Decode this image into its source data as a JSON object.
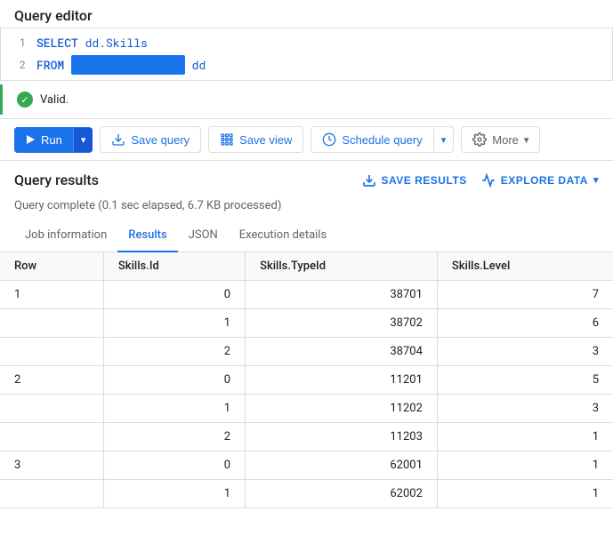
{
  "editor": {
    "label": "Query editor",
    "lines": [
      {
        "number": "1",
        "parts": [
          {
            "type": "keyword",
            "text": "SELECT"
          },
          {
            "type": "space",
            "text": " "
          },
          {
            "type": "field",
            "text": "dd.Skills"
          }
        ]
      },
      {
        "number": "2",
        "parts": [
          {
            "type": "keyword",
            "text": "FROM"
          },
          {
            "type": "space",
            "text": " "
          },
          {
            "type": "highlighted",
            "text": "                                                          "
          },
          {
            "type": "space",
            "text": " "
          },
          {
            "type": "field",
            "text": "dd"
          }
        ]
      }
    ]
  },
  "valid": {
    "text": "Valid."
  },
  "toolbar": {
    "run_label": "Run",
    "save_query_label": "Save query",
    "save_view_label": "Save view",
    "schedule_query_label": "Schedule query",
    "more_label": "More"
  },
  "results": {
    "title": "Query results",
    "save_results_label": "SAVE RESULTS",
    "explore_data_label": "EXPLORE DATA",
    "query_complete_msg": "Query complete (0.1 sec elapsed, 6.7 KB processed)",
    "tabs": [
      {
        "label": "Job information",
        "active": false
      },
      {
        "label": "Results",
        "active": true
      },
      {
        "label": "JSON",
        "active": false
      },
      {
        "label": "Execution details",
        "active": false
      }
    ],
    "columns": [
      "Row",
      "Skills.Id",
      "Skills.TypeId",
      "Skills.Level"
    ],
    "rows": [
      {
        "row": "1",
        "id": "0",
        "typeId": "38701",
        "level": "7"
      },
      {
        "row": "",
        "id": "1",
        "typeId": "38702",
        "level": "6"
      },
      {
        "row": "",
        "id": "2",
        "typeId": "38704",
        "level": "3"
      },
      {
        "row": "2",
        "id": "0",
        "typeId": "11201",
        "level": "5"
      },
      {
        "row": "",
        "id": "1",
        "typeId": "11202",
        "level": "3"
      },
      {
        "row": "",
        "id": "2",
        "typeId": "11203",
        "level": "1"
      },
      {
        "row": "3",
        "id": "0",
        "typeId": "62001",
        "level": "1"
      },
      {
        "row": "",
        "id": "1",
        "typeId": "62002",
        "level": "1"
      }
    ]
  }
}
